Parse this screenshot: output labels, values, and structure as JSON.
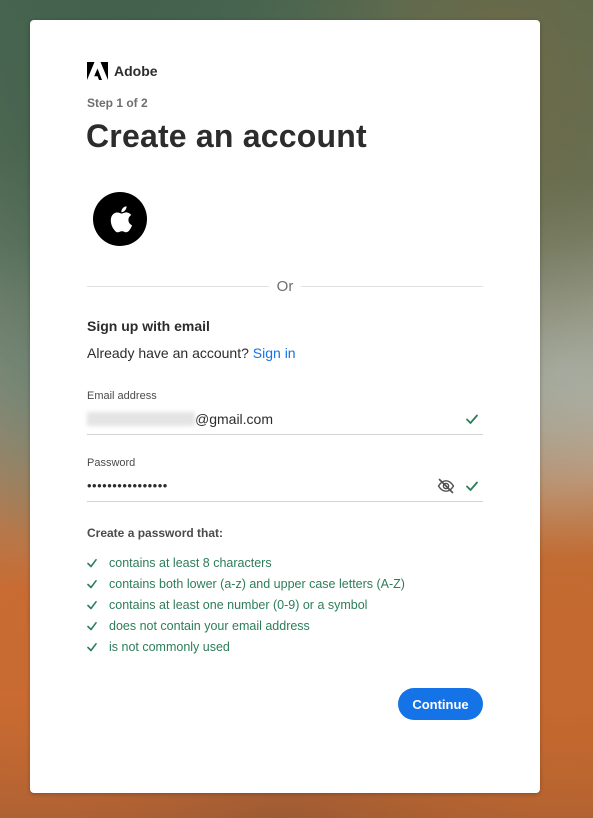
{
  "brand": {
    "name": "Adobe",
    "logo_icon": "adobe-logo-icon"
  },
  "step_text": "Step 1 of 2",
  "title": "Create an account",
  "social": {
    "apple_icon": "apple-icon"
  },
  "divider_text": "Or",
  "signup": {
    "heading": "Sign up with email",
    "have_account_text": "Already have an account?",
    "sign_in_link": "Sign in"
  },
  "email": {
    "label": "Email address",
    "value_suffix": "@gmail.com"
  },
  "password": {
    "label": "Password",
    "value_masked": "••••••••••••••••"
  },
  "rules": {
    "heading": "Create a password that:",
    "items": [
      "contains at least 8 characters",
      "contains both lower (a-z) and upper case letters (A-Z)",
      "contains at least one number (0-9) or a symbol",
      "does not contain your email address",
      "is not commonly used"
    ]
  },
  "continue_label": "Continue",
  "colors": {
    "accent": "#1473e6",
    "success": "#2d7d5a",
    "text": "#2c2c2c"
  }
}
